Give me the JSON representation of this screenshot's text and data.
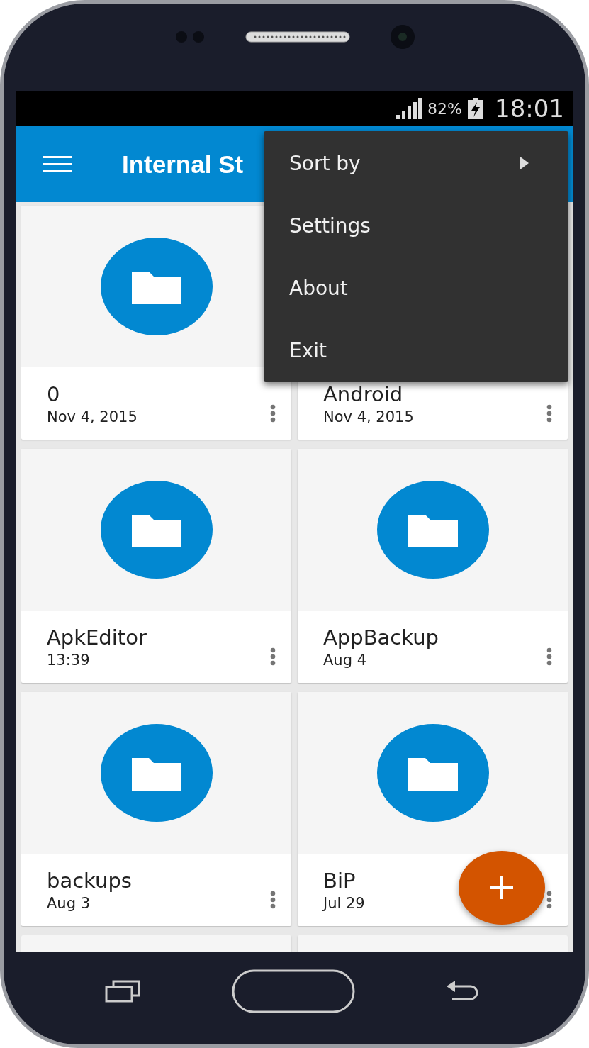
{
  "status_bar": {
    "battery": "82%",
    "time": "18:01"
  },
  "app_bar": {
    "title": "Internal St"
  },
  "menu": {
    "items": [
      {
        "label": "Sort by",
        "kind": "submenu"
      },
      {
        "label": "Settings",
        "kind": "plain"
      },
      {
        "label": "About",
        "kind": "plain"
      },
      {
        "label": "Exit",
        "kind": "plain"
      }
    ]
  },
  "folders": [
    {
      "name": "0",
      "date": "Nov 4, 2015"
    },
    {
      "name": "Android",
      "date": "Nov 4, 2015"
    },
    {
      "name": "ApkEditor",
      "date": "13:39"
    },
    {
      "name": "AppBackup",
      "date": "Aug 4"
    },
    {
      "name": "backups",
      "date": "Aug 3"
    },
    {
      "name": "BiP",
      "date": "Jul 29"
    }
  ]
}
